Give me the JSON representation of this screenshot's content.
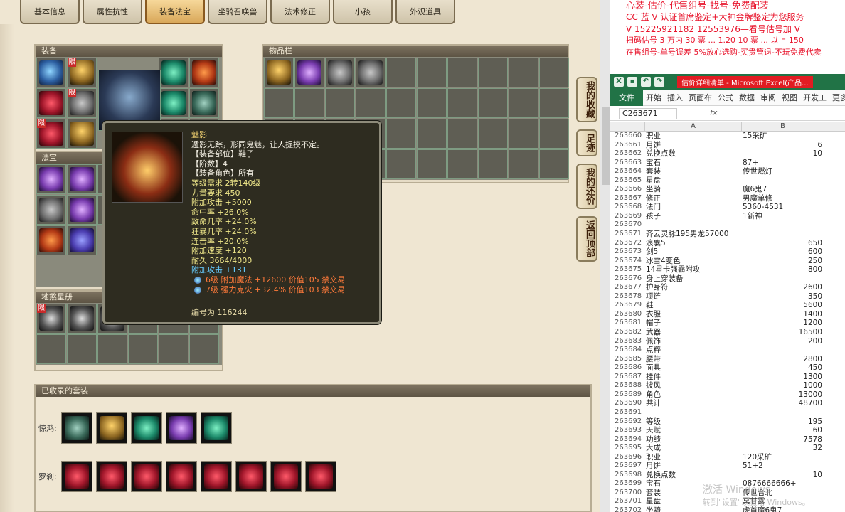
{
  "tabs": [
    "基本信息",
    "属性抗性",
    "装备法宝",
    "坐骑召唤兽",
    "法术修正",
    "小孩",
    "外观道具"
  ],
  "active_tab": 2,
  "panels": {
    "equip": "装备",
    "inventory": "物品栏",
    "fabao": "法宝",
    "dishamingce": "地煞星册",
    "suits": "已收录的套装"
  },
  "limit_label": "限",
  "side_buttons": [
    "我的收藏",
    "足迹",
    "我的还价",
    "返回顶部"
  ],
  "tooltip": {
    "name": "魅影",
    "desc": "遁影无踪，形同鬼魅，让人捉摸不定。",
    "part": "【装备部位】鞋子",
    "tier": "【阶数】4",
    "role": "【装备角色】所有",
    "level": "等级需求 2转140级",
    "str": "力量要求 450",
    "attack": "附加攻击 +5000",
    "hit": "命中率 +26.0%",
    "crit": "致命几率 +24.0%",
    "rage": "狂暴几率 +24.0%",
    "combo": "连击率 +20.0%",
    "speed": "附加速度 +120",
    "durability": "耐久 3664/4000",
    "extra_attack": "附加攻击 +131",
    "gem1": "6级 附加魔法 +12600 价值105 禁交易",
    "gem2": "7级 强力克火 +32.4% 价值103 禁交易",
    "serial": "编号为 116244"
  },
  "suits": [
    {
      "label": "惊鸿:"
    },
    {
      "label": "罗刹:"
    }
  ],
  "ads": {
    "line0": "心装-估价-代售组号-找号-免费配装",
    "line1": "CC 蓝 V 认证首席鉴定+大神金牌鉴定为您服务",
    "line2": "V 15225921182    1‍2553976—看号估号加 V",
    "line3": "扫码估号 3 万内 30 票 ... 1.20 10 票 ... 以上 150",
    "line4": "在售组号-单号误差 5%放心选购-买贵管退-不玩免费代卖"
  },
  "excel": {
    "title": "估价详细清单 - Microsoft Excel(产品...",
    "ribbon": [
      "文件",
      "开始",
      "插入",
      "页面布",
      "公式",
      "数据",
      "审阅",
      "视图",
      "开发工",
      "更多"
    ],
    "namebox": "C263671",
    "fx": "fx",
    "col_a": "A",
    "col_b": "B",
    "rows": [
      [
        "263660",
        "职业",
        "15采矿"
      ],
      [
        "263661",
        "月饼",
        "6"
      ],
      [
        "263662",
        "兑换点数",
        "10"
      ],
      [
        "263663",
        "宝石",
        "87+"
      ],
      [
        "263664",
        "套装",
        "传世燃灯"
      ],
      [
        "263665",
        "星盘",
        ""
      ],
      [
        "263666",
        "坐骑",
        "魔6鬼7"
      ],
      [
        "263667",
        "修正",
        "男魔单修"
      ],
      [
        "263668",
        "法门",
        "5360-4531"
      ],
      [
        "263669",
        "孩子",
        "1新神"
      ],
      [
        "263670",
        "",
        ""
      ],
      [
        "263671",
        "齐云灵脉195男龙57000",
        ""
      ],
      [
        "263672",
        "浪襄5",
        "650"
      ],
      [
        "263673",
        "剑5",
        "600"
      ],
      [
        "263674",
        "冰雪4变色",
        "250"
      ],
      [
        "263675",
        "14星卡强霸附攻",
        "800"
      ],
      [
        "263676",
        "身上穿装备",
        ""
      ],
      [
        "263677",
        "护身符",
        "2600"
      ],
      [
        "263678",
        "项链",
        "350"
      ],
      [
        "263679",
        "鞋",
        "5600"
      ],
      [
        "263680",
        "衣服",
        "1400"
      ],
      [
        "263681",
        "帽子",
        "1200"
      ],
      [
        "263682",
        "武器",
        "16500"
      ],
      [
        "263683",
        "佩饰",
        "200"
      ],
      [
        "263684",
        "点粹",
        ""
      ],
      [
        "263685",
        "腰带",
        "2800"
      ],
      [
        "263686",
        "面具",
        "450"
      ],
      [
        "263687",
        "挂件",
        "1300"
      ],
      [
        "263688",
        "披风",
        "1000"
      ],
      [
        "263689",
        "角色",
        "13000"
      ],
      [
        "263690",
        "共计",
        "48700"
      ],
      [
        "263691",
        "",
        ""
      ],
      [
        "263692",
        "等级",
        "195"
      ],
      [
        "263693",
        "天赋",
        "60"
      ],
      [
        "263694",
        "功绩",
        "7578"
      ],
      [
        "263695",
        "大成",
        "32"
      ],
      [
        "263696",
        "职业",
        "120采矿"
      ],
      [
        "263697",
        "月饼",
        "51+2"
      ],
      [
        "263698",
        "兑换点数",
        "10"
      ],
      [
        "263699",
        "宝石",
        "0876666666+"
      ],
      [
        "263700",
        "套装",
        "传世合北"
      ],
      [
        "263701",
        "星盘",
        "冥甘露"
      ],
      [
        "263702",
        "坐骑",
        "虎首魔6鬼7"
      ]
    ]
  },
  "watermark": {
    "line1": "激活 Windows",
    "line2": "转到\"设置\"以激活 Windows。"
  }
}
